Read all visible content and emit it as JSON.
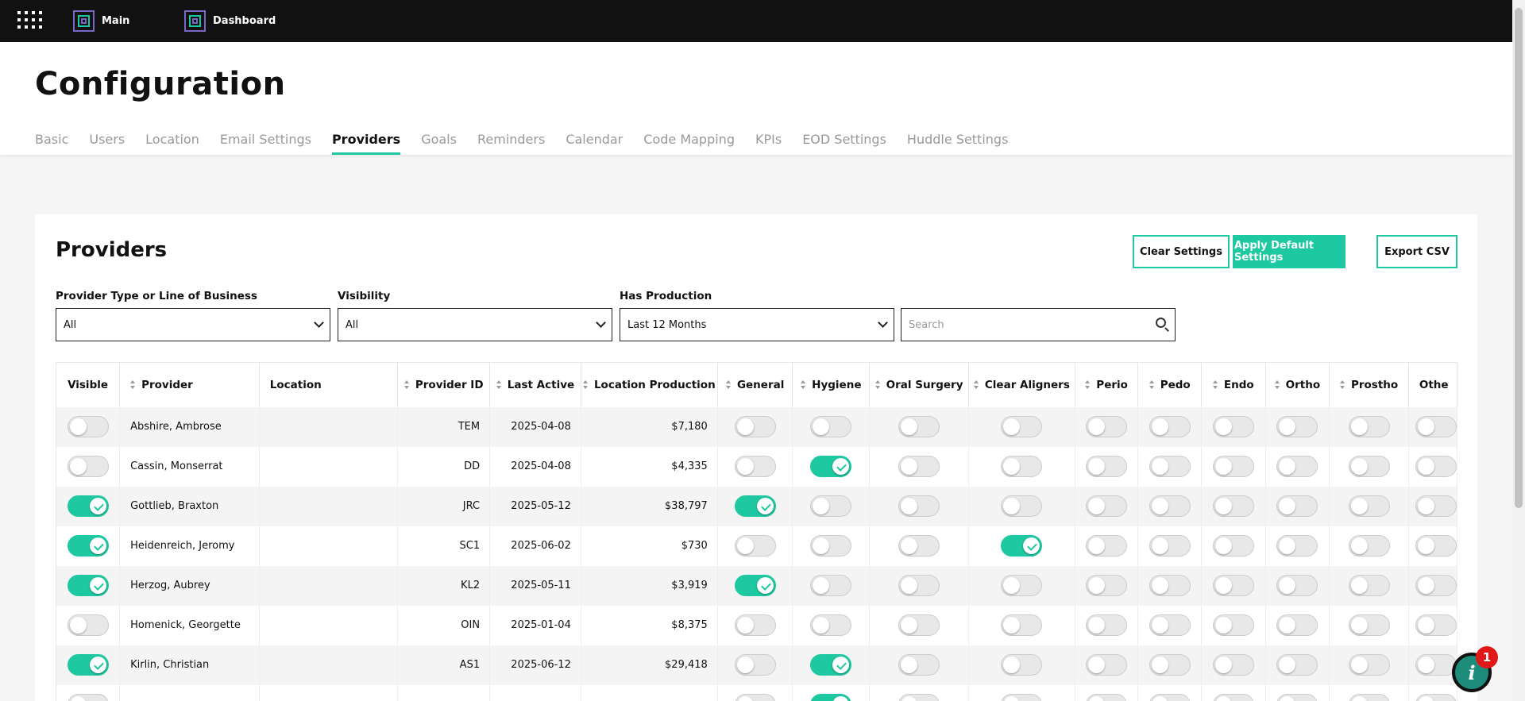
{
  "topbar": {
    "links": [
      {
        "label": "Main",
        "icon": "app-logo-icon"
      },
      {
        "label": "Dashboard",
        "icon": "app-logo-icon"
      }
    ]
  },
  "page": {
    "title": "Configuration",
    "tabs": [
      {
        "label": "Basic",
        "active": false
      },
      {
        "label": "Users",
        "active": false
      },
      {
        "label": "Location",
        "active": false
      },
      {
        "label": "Email Settings",
        "active": false
      },
      {
        "label": "Providers",
        "active": true
      },
      {
        "label": "Goals",
        "active": false
      },
      {
        "label": "Reminders",
        "active": false
      },
      {
        "label": "Calendar",
        "active": false
      },
      {
        "label": "Code Mapping",
        "active": false
      },
      {
        "label": "KPIs",
        "active": false
      },
      {
        "label": "EOD Settings",
        "active": false
      },
      {
        "label": "Huddle Settings",
        "active": false
      }
    ]
  },
  "card": {
    "title": "Providers",
    "buttons": {
      "clear": "Clear Settings",
      "apply": "Apply Default Settings",
      "export": "Export CSV"
    },
    "filters": {
      "type_label": "Provider Type or Line of Business",
      "type_value": "All",
      "visibility_label": "Visibility",
      "visibility_value": "All",
      "production_label": "Has Production",
      "production_value": "Last 12 Months",
      "search_placeholder": "Search"
    }
  },
  "table": {
    "columns": [
      "Visible",
      "Provider",
      "Location",
      "Provider ID",
      "Last Active",
      "Location Production",
      "General",
      "Hygiene",
      "Oral Surgery",
      "Clear Aligners",
      "Perio",
      "Pedo",
      "Endo",
      "Ortho",
      "Prostho",
      "Othe"
    ],
    "rows": [
      {
        "visible": false,
        "provider": "Abshire, Ambrose",
        "location": "",
        "provider_id": "TEM",
        "last_active": "2025-04-08",
        "production": "$7,180",
        "flags": [
          false,
          false,
          false,
          false,
          false,
          false,
          false,
          false,
          false,
          false
        ]
      },
      {
        "visible": false,
        "provider": "Cassin, Monserrat",
        "location": "",
        "provider_id": "DD",
        "last_active": "2025-04-08",
        "production": "$4,335",
        "flags": [
          false,
          true,
          false,
          false,
          false,
          false,
          false,
          false,
          false,
          false
        ]
      },
      {
        "visible": true,
        "provider": "Gottlieb, Braxton",
        "location": "",
        "provider_id": "JRC",
        "last_active": "2025-05-12",
        "production": "$38,797",
        "flags": [
          true,
          false,
          false,
          false,
          false,
          false,
          false,
          false,
          false,
          false
        ]
      },
      {
        "visible": true,
        "provider": "Heidenreich, Jeromy",
        "location": "",
        "provider_id": "SC1",
        "last_active": "2025-06-02",
        "production": "$730",
        "flags": [
          false,
          false,
          false,
          true,
          false,
          false,
          false,
          false,
          false,
          false
        ]
      },
      {
        "visible": true,
        "provider": "Herzog, Aubrey",
        "location": "",
        "provider_id": "KL2",
        "last_active": "2025-05-11",
        "production": "$3,919",
        "flags": [
          true,
          false,
          false,
          false,
          false,
          false,
          false,
          false,
          false,
          false
        ]
      },
      {
        "visible": false,
        "provider": "Homenick, Georgette",
        "location": "",
        "provider_id": "OIN",
        "last_active": "2025-01-04",
        "production": "$8,375",
        "flags": [
          false,
          false,
          false,
          false,
          false,
          false,
          false,
          false,
          false,
          false
        ]
      },
      {
        "visible": true,
        "provider": "Kirlin, Christian",
        "location": "",
        "provider_id": "AS1",
        "last_active": "2025-06-12",
        "production": "$29,418",
        "flags": [
          false,
          true,
          false,
          false,
          false,
          false,
          false,
          false,
          false,
          false
        ]
      },
      {
        "visible": false,
        "provider": "",
        "location": "",
        "provider_id": "",
        "last_active": "",
        "production": "",
        "flags": [
          false,
          true,
          false,
          false,
          false,
          false,
          false,
          false,
          false,
          false
        ]
      }
    ]
  },
  "help": {
    "badge": "1",
    "glyph": "i"
  },
  "colors": {
    "accent": "#1ec8a0",
    "topbar": "#111111",
    "badge": "#e01818"
  }
}
